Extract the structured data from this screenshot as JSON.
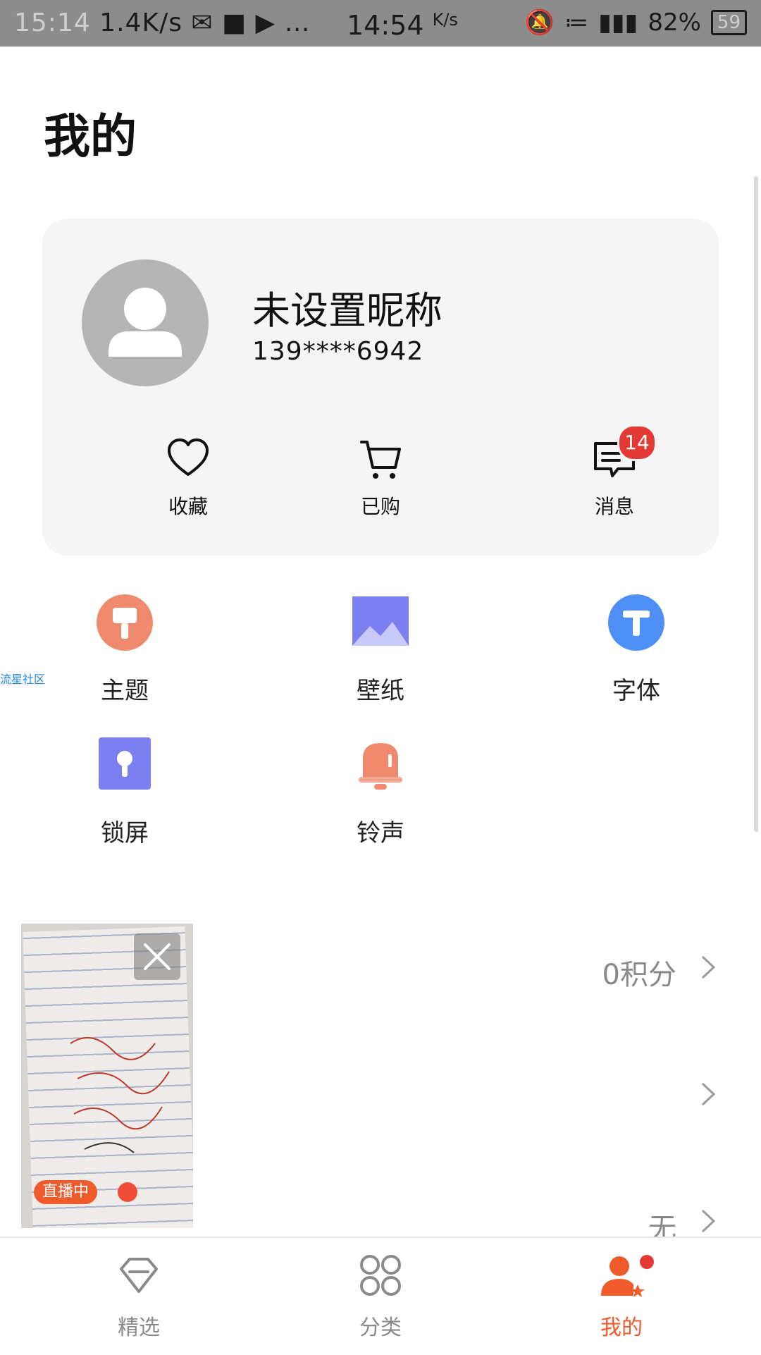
{
  "status_bar": {
    "time": "15:14",
    "left_speed": "1.4K/s",
    "center_speed": "14:54",
    "center_speed_unit": "K/s",
    "battery": "82%",
    "battery_ghost": "59"
  },
  "page": {
    "title": "我的"
  },
  "profile": {
    "nickname": "未设置昵称",
    "phone": "139****6942",
    "actions": [
      {
        "label": "收藏",
        "icon": "heart-icon"
      },
      {
        "label": "已购",
        "icon": "cart-icon"
      },
      {
        "label": "消息",
        "icon": "message-icon",
        "badge": "14"
      }
    ]
  },
  "features": [
    {
      "label": "主题",
      "icon": "brush-icon",
      "color": "#f08a6e"
    },
    {
      "label": "壁纸",
      "icon": "image-icon",
      "color": "#7b7ff0"
    },
    {
      "label": "字体",
      "icon": "font-t-icon",
      "color": "#4e8ff5"
    },
    {
      "label": "锁屏",
      "icon": "lock-keyhole-icon",
      "color": "#7b7ff0"
    },
    {
      "label": "铃声",
      "icon": "bell-icon",
      "color": "#f08a6e"
    }
  ],
  "side_link": "流星社区",
  "rows": [
    {
      "value": "0积分"
    },
    {
      "value": ""
    },
    {
      "value": "无"
    }
  ],
  "video": {
    "live_label": "直播中"
  },
  "bottom_nav": [
    {
      "label": "精选",
      "icon": "diamond-icon",
      "active": false
    },
    {
      "label": "分类",
      "icon": "grid-icon",
      "active": false
    },
    {
      "label": "我的",
      "icon": "user-star-icon",
      "active": true
    }
  ],
  "colors": {
    "accent": "#ef5b2b",
    "badge": "#e53935",
    "card_bg": "#f5f5f5"
  }
}
